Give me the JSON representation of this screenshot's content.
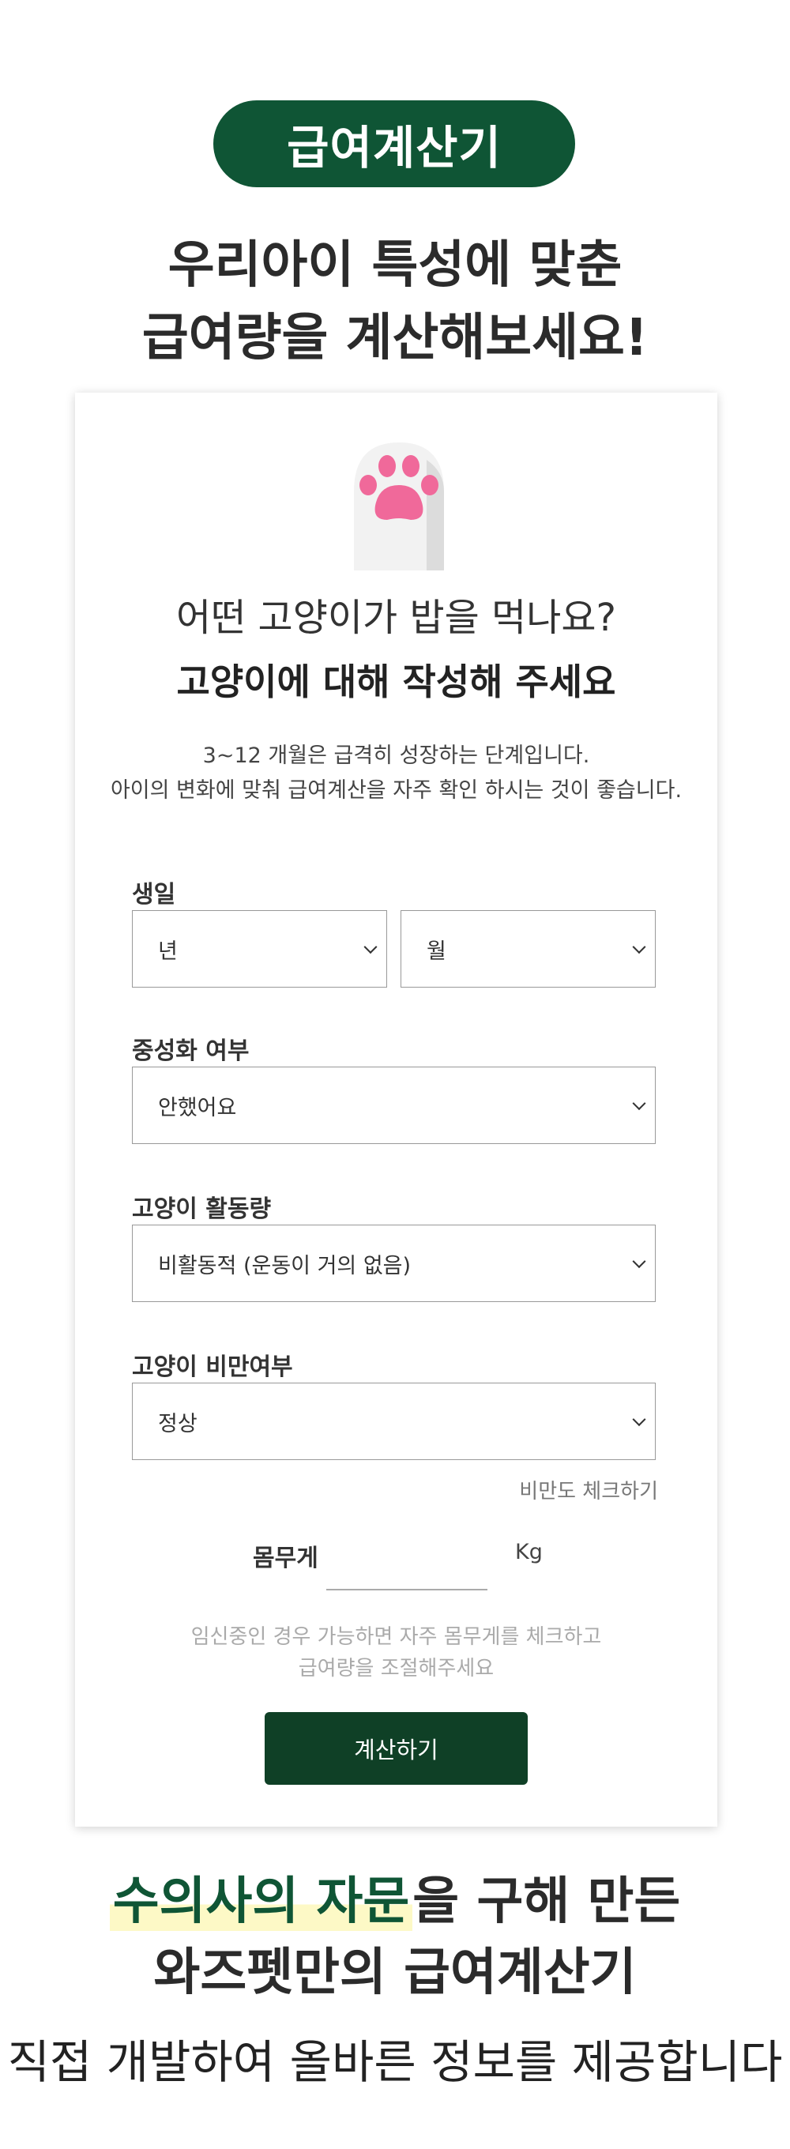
{
  "badge": "급여계산기",
  "headline": {
    "line1": "우리아이 특성에 맞춘",
    "line2": "급여량을 계산해보세요!"
  },
  "card": {
    "question": "어떤 고양이가 밥을 먹나요?",
    "question_bold": "고양이에 대해 작성해 주세요",
    "info_line1": "3~12 개월은 급격히 성장하는 단계입니다.",
    "info_line2": "아이의 변화에 맞춰 급여계산을 자주 확인 하시는 것이 좋습니다.",
    "birthday": {
      "label": "생일",
      "year": "년",
      "month": "월"
    },
    "neuter": {
      "label": "중성화 여부",
      "value": "안했어요"
    },
    "activity": {
      "label": "고양이 활동량",
      "value": "비활동적 (운동이 거의 없음)"
    },
    "obesity": {
      "label": "고양이 비만여부",
      "value": "정상"
    },
    "obesity_check_link": "비만도 체크하기",
    "weight": {
      "label": "몸무게",
      "unit": "Kg",
      "value": ""
    },
    "note_line1": "임신중인 경우 가능하면 자주 몸무게를 체크하고",
    "note_line2": "급여량을 조절해주세요",
    "calculate_button": "계산하기"
  },
  "footer": {
    "highlight": "수의사의 자문",
    "line1_rest": "을 구해 만든",
    "line2": "와즈펫만의 급여계산기",
    "line3": "직접 개발하여 올바른 정보를 제공합니다"
  },
  "colors": {
    "brand_green": "#0f5535",
    "button_green": "#0f4026",
    "paw_pink": "#f0699a",
    "highlight_yellow": "#fdf9c6"
  }
}
